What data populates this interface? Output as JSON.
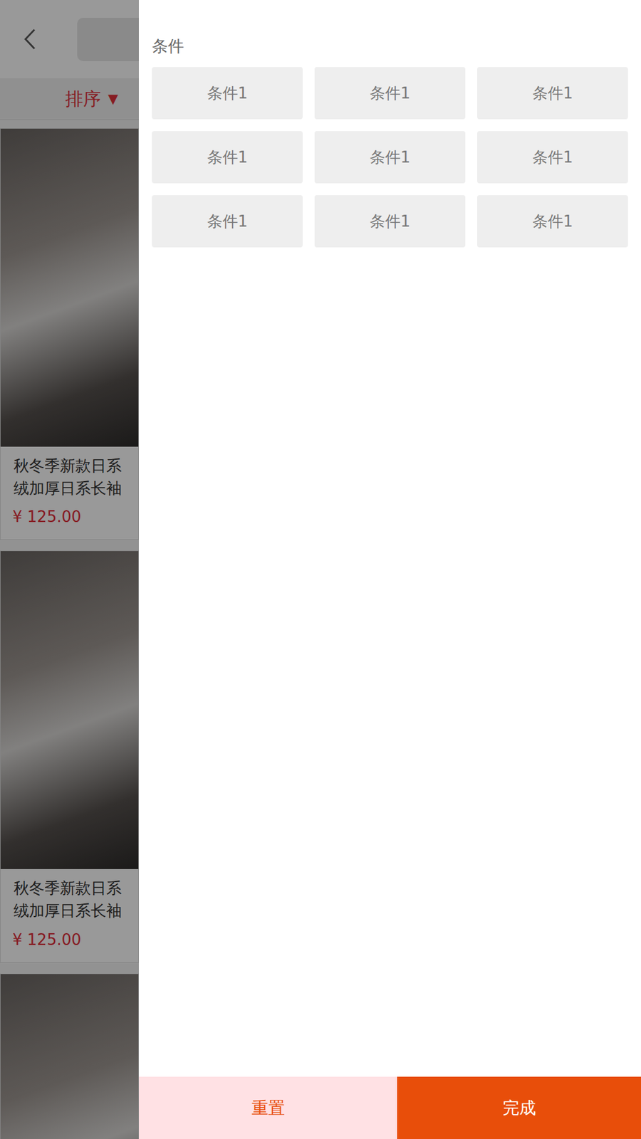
{
  "sort": {
    "label": "排序",
    "icon": "▼"
  },
  "products": [
    {
      "title_lines": [
        "秋冬季新款日系",
        "绒加厚日系长袖"
      ],
      "price": "¥ 125.00"
    },
    {
      "title_lines": [
        "秋冬季新款日系",
        "绒加厚日系长袖"
      ],
      "price": "¥ 125.00"
    }
  ],
  "filter": {
    "title": "条件",
    "options": [
      {
        "label": "条件1",
        "selected": false
      },
      {
        "label": "条件1",
        "selected": false
      },
      {
        "label": "条件1",
        "selected": false
      },
      {
        "label": "条件1",
        "selected": false
      },
      {
        "label": "条件1",
        "selected": false
      },
      {
        "label": "条件1",
        "selected": false
      },
      {
        "label": "条件1",
        "selected": false
      },
      {
        "label": "条件1",
        "selected": false
      },
      {
        "label": "条件1",
        "selected": false
      }
    ]
  },
  "actions": [
    {
      "label": "重置",
      "kind": "reset"
    },
    {
      "label": "完成",
      "kind": "confirm"
    }
  ]
}
